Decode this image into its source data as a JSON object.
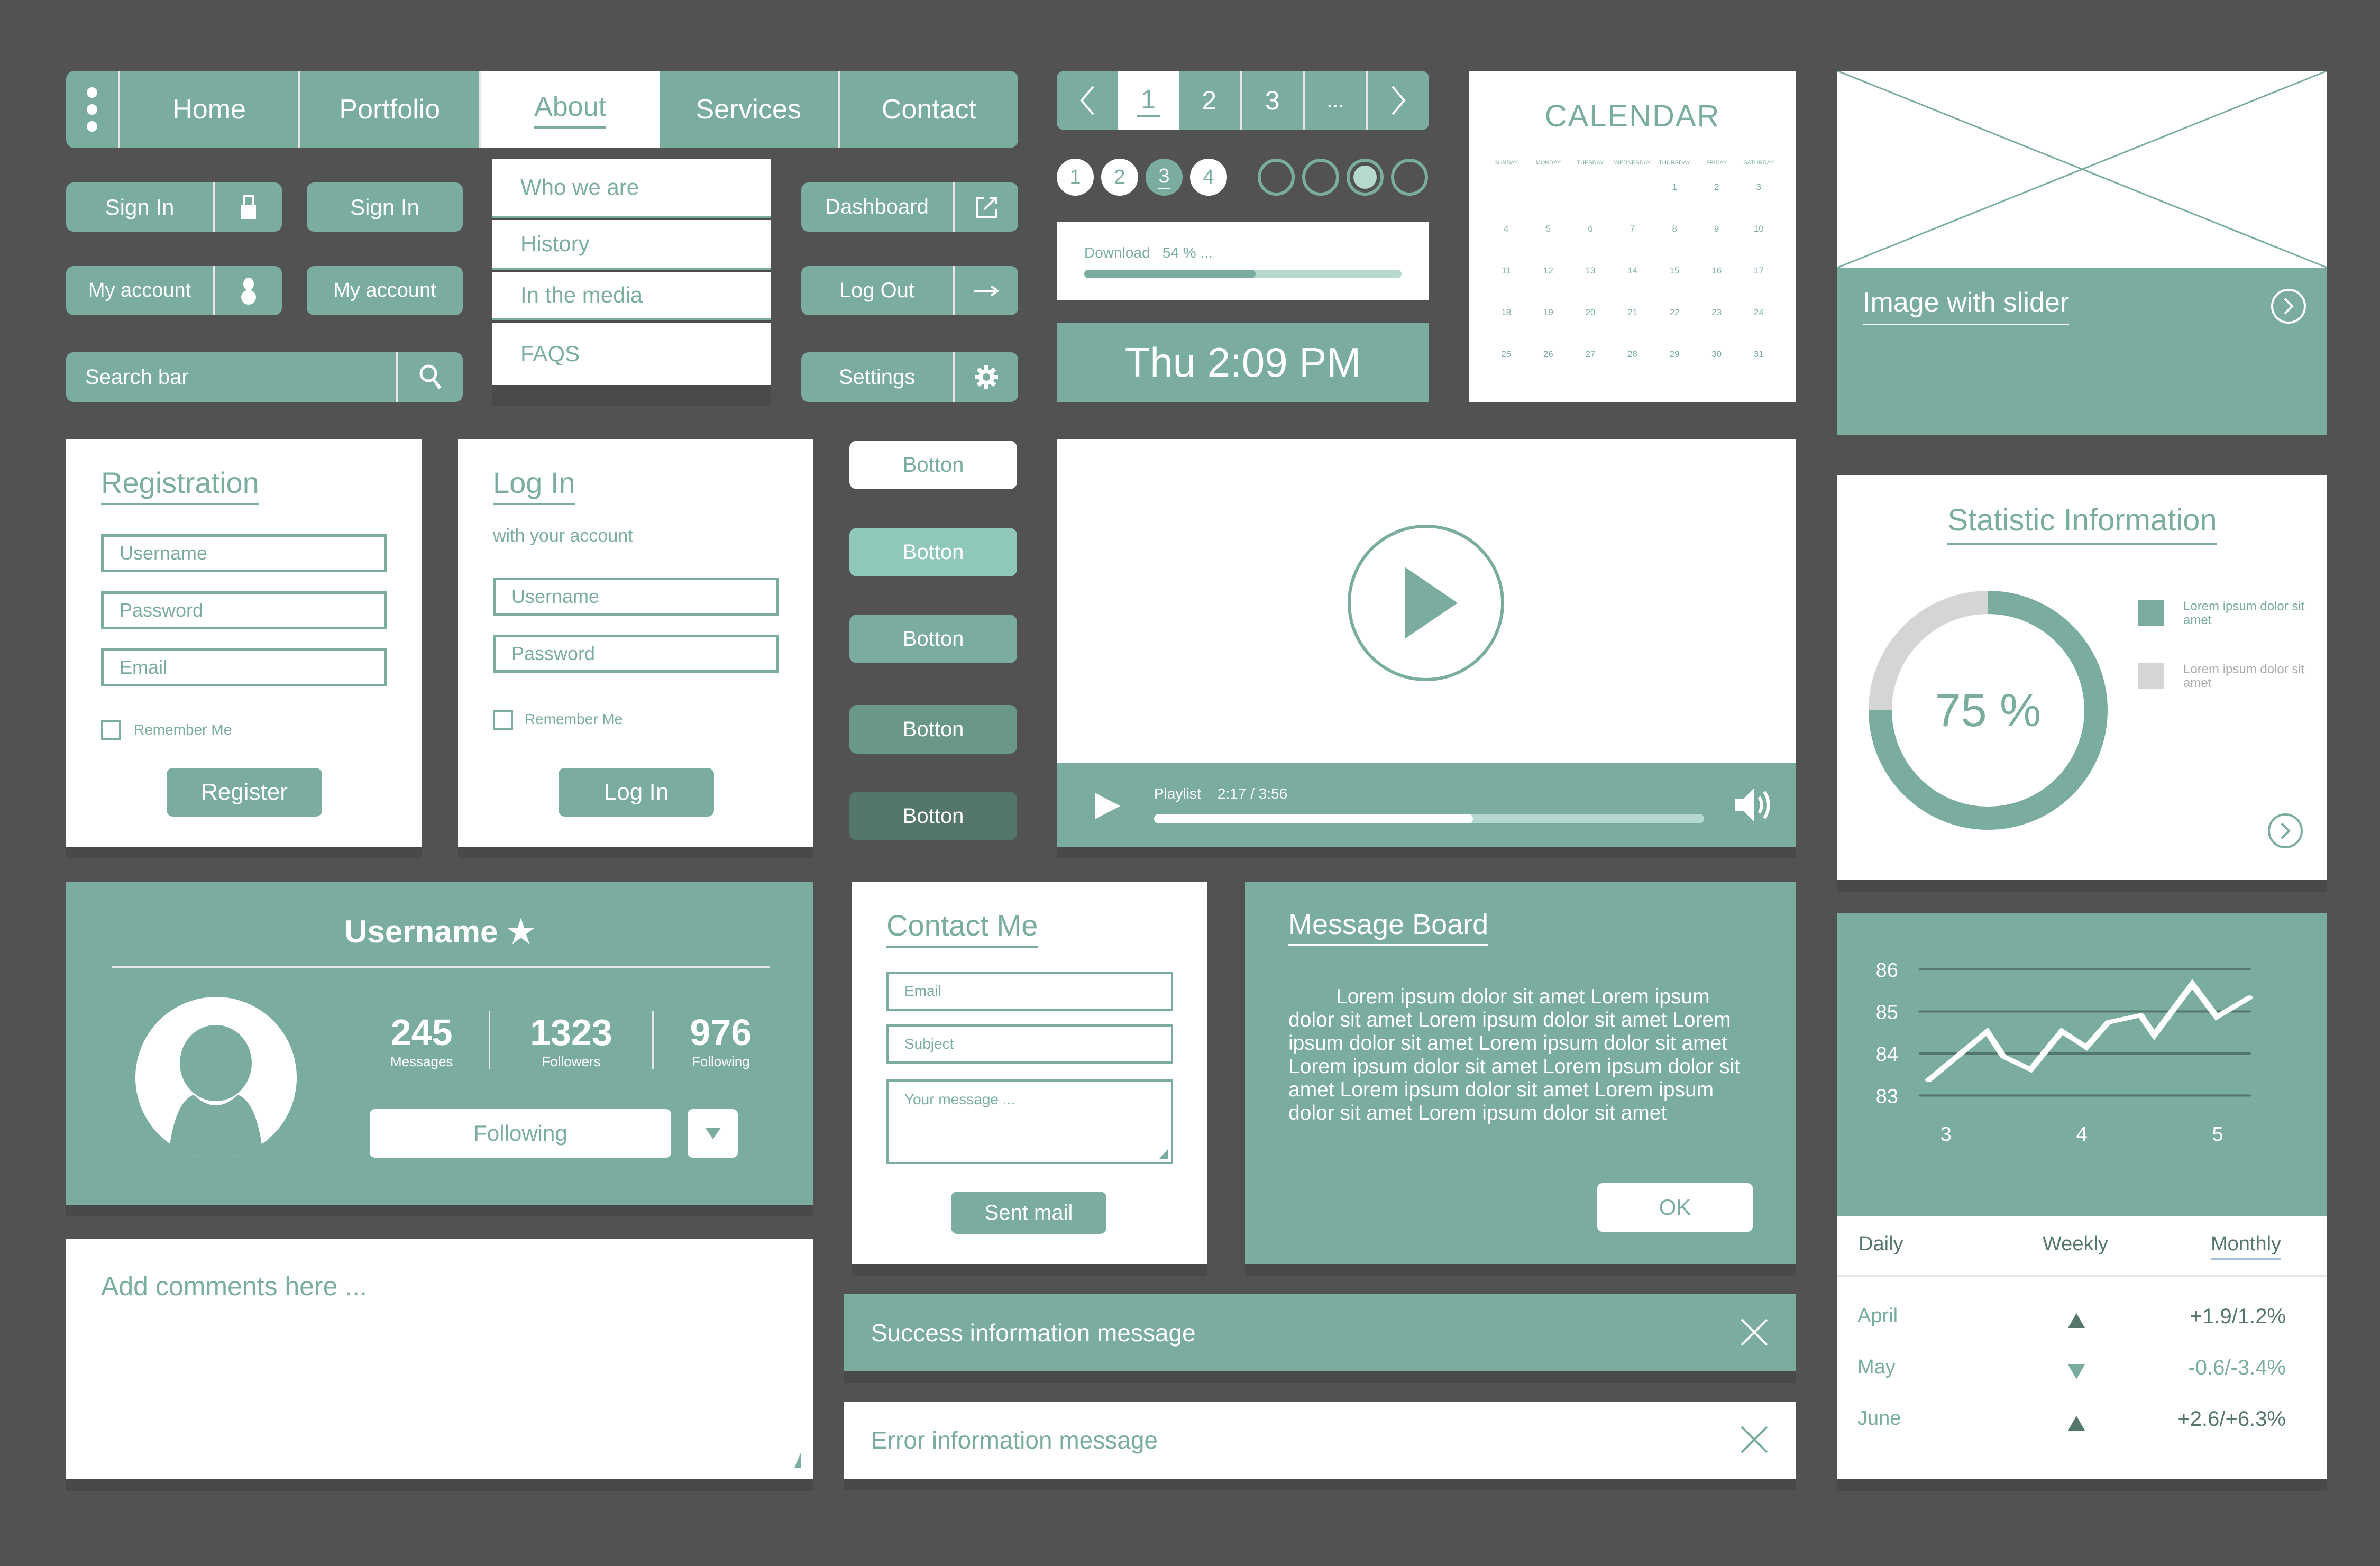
{
  "colors": {
    "background": "#525252",
    "accent": "#7aada0",
    "accent_light": "#8fc7b8",
    "accent_dark": "#6a9888",
    "accent_darker": "#55766d",
    "track": "#b5d9ce",
    "gray_segment": "#d6d5d6",
    "up_color": "#55766d",
    "down_color": "#7aada0"
  },
  "nav": {
    "menu_icon": "kebab-menu-icon",
    "tabs": [
      {
        "label": "Home",
        "active": false
      },
      {
        "label": "Portfolio",
        "active": false
      },
      {
        "label": "About",
        "active": true
      },
      {
        "label": "Services",
        "active": false
      },
      {
        "label": "Contact",
        "active": false
      }
    ]
  },
  "buttons_left": {
    "sign_in_icon": "Sign In",
    "sign_in": "Sign In",
    "my_account_icon": "My account",
    "my_account": "My account",
    "search_placeholder": "Search bar"
  },
  "dropdown": {
    "items": [
      "Who we are",
      "History",
      "In the media",
      "FAQS"
    ]
  },
  "buttons_right": {
    "dashboard": "Dashboard",
    "logout": "Log Out",
    "settings": "Settings"
  },
  "pagination": {
    "prev": "<",
    "pages": [
      "1",
      "2",
      "3",
      "..."
    ],
    "active_page": "1",
    "next": ">"
  },
  "step_dots": {
    "numbers": [
      "1",
      "2",
      "3",
      "4"
    ],
    "active_number": "3",
    "ring_count": 4,
    "active_ring": 3
  },
  "download": {
    "label": "Download",
    "percent_label": "54 % ...",
    "progress": 0.54
  },
  "clock": {
    "text": "Thu 2:09 PM"
  },
  "calendar": {
    "title": "CALENDAR",
    "days": [
      "SUNDAY",
      "MONDAY",
      "TUESDAY",
      "WEDNESDAY",
      "THURSDAY",
      "FRIDAY",
      "SATURDAY"
    ],
    "first_weekday": 4,
    "num_days": 31
  },
  "slider": {
    "caption": "Image with slider"
  },
  "registration": {
    "title": "Registration",
    "username_placeholder": "Username",
    "password_placeholder": "Password",
    "email_placeholder": "Email",
    "remember": "Remember Me",
    "submit": "Register"
  },
  "login": {
    "title": "Log In",
    "subtitle": "with your account",
    "username_placeholder": "Username",
    "password_placeholder": "Password",
    "remember": "Remember Me",
    "submit": "Log In"
  },
  "botton_states": [
    {
      "label": "Botton",
      "variant": "white"
    },
    {
      "label": "Botton",
      "variant": "light"
    },
    {
      "label": "Botton",
      "variant": "normal"
    },
    {
      "label": "Botton",
      "variant": "dark"
    },
    {
      "label": "Botton",
      "variant": "darker"
    }
  ],
  "video": {
    "playlist_label": "Playlist",
    "time": "2:17 / 3:56",
    "progress": 0.58
  },
  "stats": {
    "title": "Statistic Information",
    "percent_label": "75 %",
    "value": 0.75,
    "legend": [
      {
        "label": "Lorem ipsum dolor sit amet",
        "color": "#7aada0"
      },
      {
        "label": "Lorem ipsum dolor sit amet",
        "color": "#d6d5d6"
      }
    ]
  },
  "profile": {
    "username": "Username",
    "star": "★",
    "stats": [
      {
        "value": "245",
        "label": "Messages"
      },
      {
        "value": "1323",
        "label": "Followers"
      },
      {
        "value": "976",
        "label": "Following"
      }
    ],
    "follow_button": "Following"
  },
  "contact": {
    "title": "Contact Me",
    "email_placeholder": "Email",
    "subject_placeholder": "Subject",
    "message_placeholder": "Your message ...",
    "submit": "Sent mail"
  },
  "message_board": {
    "title": "Message Board",
    "body": "Lorem ipsum dolor sit amet Lorem ipsum dolor sit amet Lorem ipsum dolor sit amet Lorem ipsum dolor sit amet Lorem ipsum dolor sit amet Lorem ipsum dolor sit amet Lorem ipsum dolor sit amet Lorem ipsum dolor sit amet Lorem ipsum dolor sit amet Lorem ipsum dolor sit amet",
    "ok": "OK"
  },
  "comments": {
    "placeholder": "Add comments here ..."
  },
  "alerts": {
    "success": "Success information message",
    "error": "Error information message"
  },
  "chart_data": {
    "type": "line",
    "title": "",
    "xlabel": "",
    "ylabel": "",
    "x_ticks": [
      "3",
      "4",
      "5"
    ],
    "y_ticks": [
      "86",
      "85",
      "84",
      "83"
    ],
    "xlim": [
      2.8,
      5.25
    ],
    "ylim": [
      83,
      86
    ],
    "grid": true,
    "series": [
      {
        "name": "value",
        "x": [
          2.85,
          3.28,
          3.4,
          3.6,
          3.83,
          4.01,
          4.17,
          4.41,
          4.51,
          4.79,
          4.97,
          5.21
        ],
        "y": [
          83.37,
          84.52,
          83.93,
          83.62,
          84.53,
          84.15,
          84.74,
          84.91,
          84.44,
          85.65,
          84.87,
          85.33
        ]
      }
    ]
  },
  "period_tabs": {
    "tabs": [
      "Daily",
      "Weekly",
      "Monthly"
    ],
    "active": "Monthly"
  },
  "trend_rows": [
    {
      "month": "April",
      "direction": "up",
      "value": "+1.9/1.2%"
    },
    {
      "month": "May",
      "direction": "down",
      "value": "-0.6/-3.4%"
    },
    {
      "month": "June",
      "direction": "up",
      "value": "+2.6/+6.3%"
    }
  ]
}
